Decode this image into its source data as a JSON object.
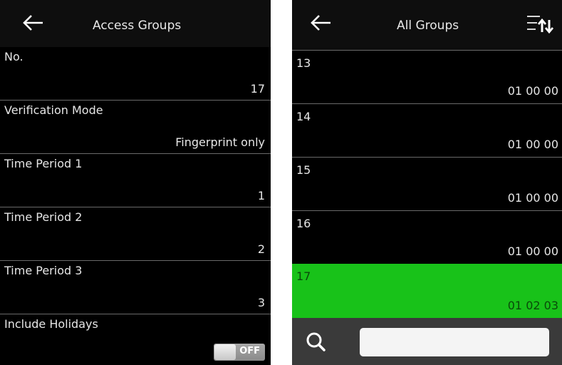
{
  "access_groups": {
    "title": "Access Groups",
    "fields": [
      {
        "label": "No.",
        "value": "17"
      },
      {
        "label": "Verification Mode",
        "value": "Fingerprint only"
      },
      {
        "label": "Time Period 1",
        "value": "1"
      },
      {
        "label": "Time Period 2",
        "value": "2"
      },
      {
        "label": "Time Period 3",
        "value": "3"
      }
    ],
    "include_holidays": {
      "label": "Include Holidays",
      "toggle_text": "OFF",
      "state": "off"
    }
  },
  "all_groups": {
    "title": "All Groups",
    "groups": [
      {
        "no": "13",
        "periods": "01 00 00"
      },
      {
        "no": "14",
        "periods": "01 00 00"
      },
      {
        "no": "15",
        "periods": "01 00 00"
      },
      {
        "no": "16",
        "periods": "01 00 00"
      },
      {
        "no": "17",
        "periods": "01 02 03",
        "selected": true
      }
    ],
    "search": {
      "value": "",
      "placeholder": ""
    }
  },
  "colors": {
    "selected_row": "#18c219",
    "background": "#000000",
    "search_bar": "#3a3a3a"
  },
  "icons": {
    "back": "back-arrow-icon",
    "sort": "sort-icon",
    "search": "search-icon"
  }
}
